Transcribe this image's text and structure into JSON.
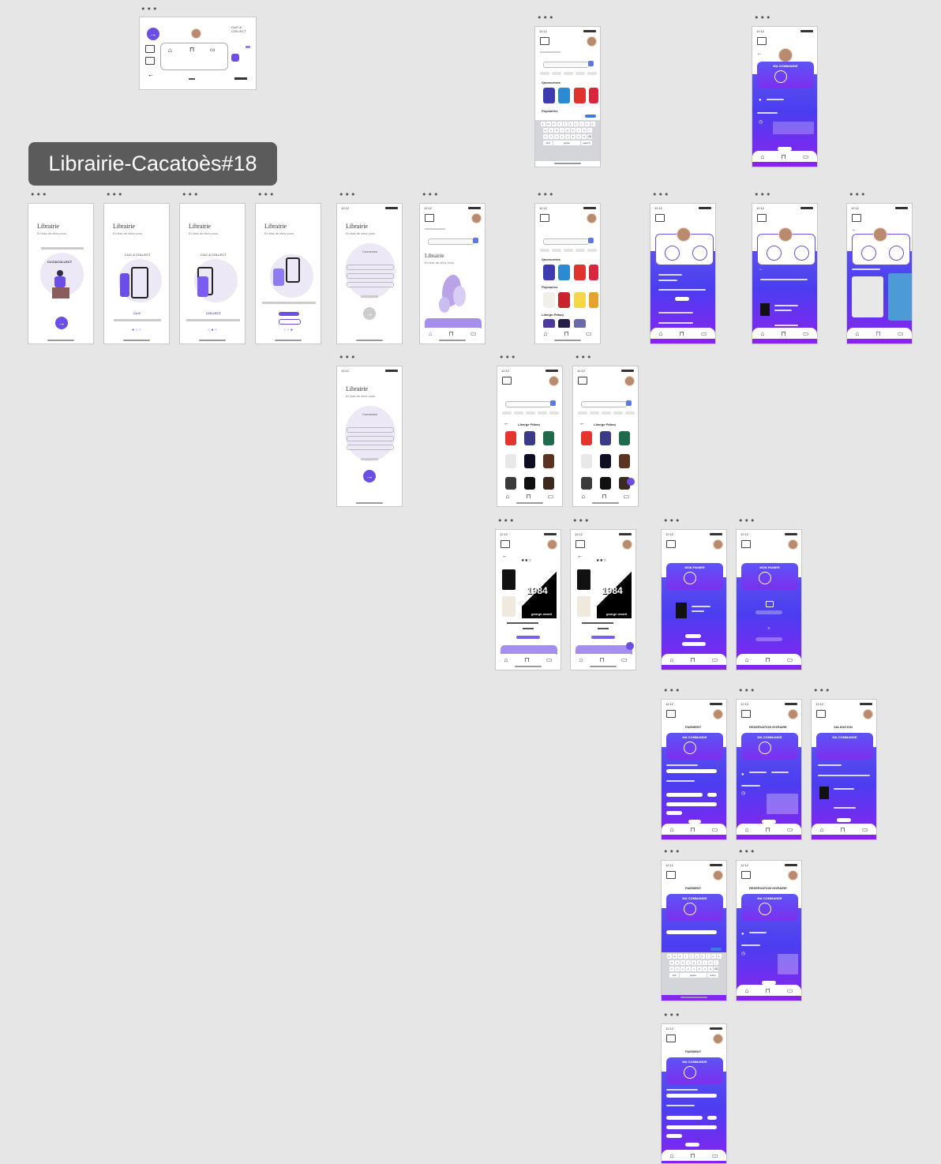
{
  "canvas": {
    "background": "#e6e6e6"
  },
  "section_label": "Librairie-Cacatoès#18",
  "frame_menu_glyph": "•••",
  "colors": {
    "accent": "#6c4de6",
    "gradient_start": "#5a4ff0",
    "gradient_end": "#8a22f0",
    "search_blue": "#5a78e8"
  },
  "onboarding": {
    "app_name": "Librairie",
    "tagline": "En bas de chez vous",
    "screen1_caption": "CLIC&COLLECT",
    "screen2_caption": "CLIC & COLLECT",
    "screen2_step": "CLIC",
    "screen3_caption": "CLIC & COLLECT",
    "screen3_step": "COLLECT",
    "login_heading": "Connexion"
  },
  "top_frame": {
    "label": "CLIC & COLLECT"
  },
  "home": {
    "hero_title": "Librairie",
    "hero_sub": "En bas de chez vous",
    "section_sponsored": "Sponsorisés",
    "section_popular": "Populaires",
    "section_category": "Liberge Pitbeq"
  },
  "book_detail": {
    "cover_title": "1984",
    "author": "george orwell",
    "rating": "★★☆"
  },
  "cart": {
    "title": "MON PANIER"
  },
  "order": {
    "title": "MA COMMANDE"
  },
  "flow": {
    "payment": "PAIEMENT",
    "reservation": "RESERVATION HORAIRE",
    "validation": "VALIDATION"
  },
  "icons": [
    "arrow-right-icon",
    "home-icon",
    "bookmark-icon",
    "calendar-icon",
    "book-icon",
    "search-icon",
    "back-arrow-icon",
    "location-pin-icon",
    "clock-icon"
  ]
}
